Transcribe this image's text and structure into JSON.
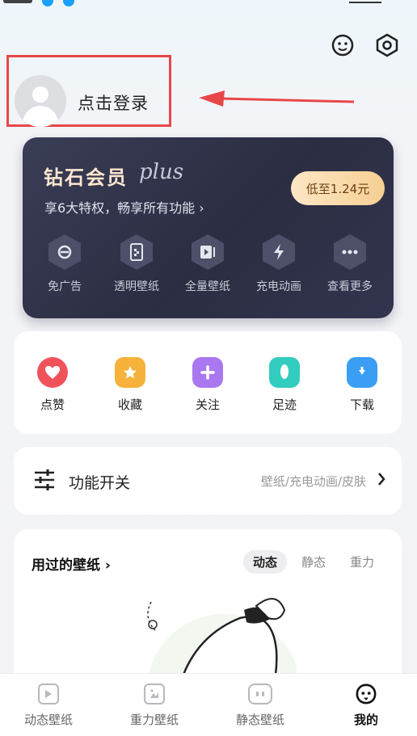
{
  "profile": {
    "login_label": "点击登录"
  },
  "vip": {
    "title": "钻石会员",
    "plus": "plus",
    "subtitle": "享6大特权，畅享所有功能 ›",
    "price_button": "低至1.24元",
    "features": [
      {
        "label": "免广告",
        "icon": "no-ads-icon"
      },
      {
        "label": "透明壁纸",
        "icon": "transparent-wallpaper-icon"
      },
      {
        "label": "全量壁纸",
        "icon": "all-wallpaper-icon"
      },
      {
        "label": "充电动画",
        "icon": "charging-icon"
      },
      {
        "label": "查看更多",
        "icon": "more-icon"
      }
    ]
  },
  "quick_actions": [
    {
      "label": "点赞",
      "icon": "heart-icon",
      "color": "#f0525c"
    },
    {
      "label": "收藏",
      "icon": "star-icon",
      "color": "#f7b23b"
    },
    {
      "label": "关注",
      "icon": "plus-icon",
      "color": "#a978f0"
    },
    {
      "label": "足迹",
      "icon": "footprint-icon",
      "color": "#33cdbf"
    },
    {
      "label": "下载",
      "icon": "download-folder-icon",
      "color": "#3b9ef5"
    }
  ],
  "feature_switch": {
    "title": "功能开关",
    "subtitle": "壁纸/充电动画/皮肤"
  },
  "used_wallpapers": {
    "title": "用过的壁纸 ›",
    "tabs": [
      "动态",
      "静态",
      "重力"
    ],
    "active_tab": "动态"
  },
  "bottom_nav": [
    {
      "label": "动态壁纸",
      "icon": "play-icon"
    },
    {
      "label": "重力壁纸",
      "icon": "gravity-icon"
    },
    {
      "label": "静态壁纸",
      "icon": "image-icon"
    },
    {
      "label": "我的",
      "icon": "profile-face-icon"
    }
  ],
  "colors": {
    "annotation_red": "#e8474a",
    "vip_card": "#2f3148",
    "vip_gold": "#f6cf93"
  }
}
